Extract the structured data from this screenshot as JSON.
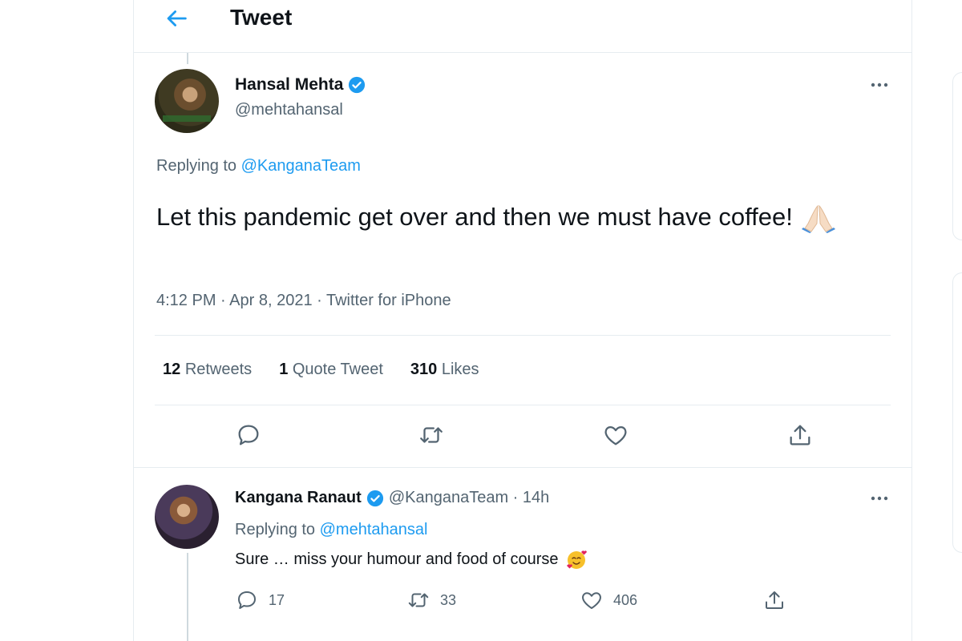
{
  "header": {
    "title": "Tweet"
  },
  "main_tweet": {
    "name": "Hansal Mehta",
    "handle": "@mehtahansal",
    "replying_prefix": "Replying to",
    "replying_to": "@KanganaTeam",
    "text": "Let this pandemic get over and then we must have coffee!",
    "meta": "4:12 PM · Apr 8, 2021 · Twitter for iPhone",
    "stats": {
      "retweets_count": "12",
      "retweets_label": "Retweets",
      "quotes_count": "1",
      "quotes_label": "Quote Tweet",
      "likes_count": "310",
      "likes_label": "Likes"
    }
  },
  "reply_tweet": {
    "name": "Kangana Ranaut",
    "handle_time": "@KanganaTeam · 14h",
    "replying_prefix": "Replying to",
    "replying_to": "@mehtahansal",
    "text": "Sure … miss your humour and food of course",
    "reply_count": "17",
    "retweet_count": "33",
    "like_count": "406"
  },
  "icons": {
    "back": "arrow-left-icon",
    "more": "more-dots-icon",
    "verified": "verified-badge-icon",
    "reply": "reply-icon",
    "retweet": "retweet-icon",
    "like": "heart-icon",
    "share": "share-icon"
  },
  "colors": {
    "accent": "#1d9bf0",
    "text": "#0f1419",
    "muted": "#536471",
    "border": "#e6ecf0"
  }
}
